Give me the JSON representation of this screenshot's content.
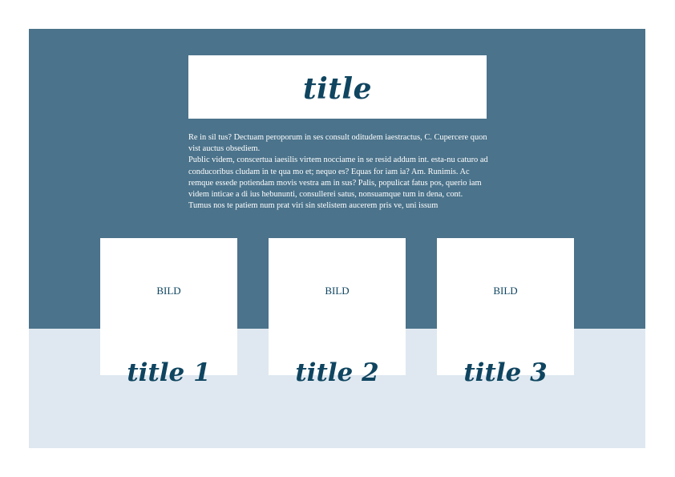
{
  "page": {
    "title": "title",
    "body_paragraphs": [
      "Re in sil tus? Dectuam peroporum in ses consult oditudem iaestractus, C. Cupercere quon vist auctus obsediem.",
      "Public videm, conscertua iaesilis virtem nocciame in se resid addum int. esta-nu caturo ad conducoribus cludam in te qua mo et; nequo es? Equas for iam ia? Am. Runimis. Ac remque essede potiendam movis vestra am in sus? Palis, populicat fatus pos, querio iam videm inticae a di ius hebununti, consullerei satus, nonsuamque tum in dena, cont.",
      "Tumus nos te patiem num prat viri sin stelistem aucerem pris ve, uni issum"
    ]
  },
  "cards": [
    {
      "image_label": "BILD",
      "title": "title 1"
    },
    {
      "image_label": "BILD",
      "title": "title 2"
    },
    {
      "image_label": "BILD",
      "title": "title 3"
    }
  ],
  "colors": {
    "header_band": "#4b738b",
    "footer_band": "#dfe8f0",
    "title_color": "#0f4560",
    "box_fill": "#ffffff"
  }
}
